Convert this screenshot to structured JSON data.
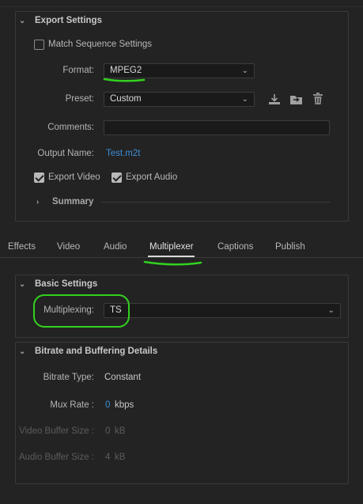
{
  "export_settings": {
    "title": "Export Settings",
    "match_sequence_label": "Match Sequence Settings",
    "format_label": "Format:",
    "format_value": "MPEG2",
    "preset_label": "Preset:",
    "preset_value": "Custom",
    "comments_label": "Comments:",
    "comments_value": "",
    "output_name_label": "Output Name:",
    "output_name_value": "Test.m2t",
    "export_video_label": "Export Video",
    "export_audio_label": "Export Audio",
    "summary_label": "Summary"
  },
  "tabs": [
    "Effects",
    "Video",
    "Audio",
    "Multiplexer",
    "Captions",
    "Publish"
  ],
  "active_tab": "Multiplexer",
  "basic_settings": {
    "title": "Basic Settings",
    "multiplexing_label": "Multiplexing:",
    "multiplexing_value": "TS"
  },
  "bitrate": {
    "title": "Bitrate and Buffering Details",
    "bitrate_type_label": "Bitrate Type:",
    "bitrate_type_value": "Constant",
    "mux_rate_label": "Mux Rate :",
    "mux_rate_value": "0",
    "mux_rate_unit": "kbps",
    "video_buffer_label": "Video Buffer Size :",
    "video_buffer_value": "0",
    "video_buffer_unit": "kB",
    "audio_buffer_label": "Audio Buffer Size :",
    "audio_buffer_value": "4",
    "audio_buffer_unit": "kB"
  },
  "colors": {
    "background": "#232323",
    "link": "#3d8ed8",
    "annotation": "#33d11f"
  }
}
